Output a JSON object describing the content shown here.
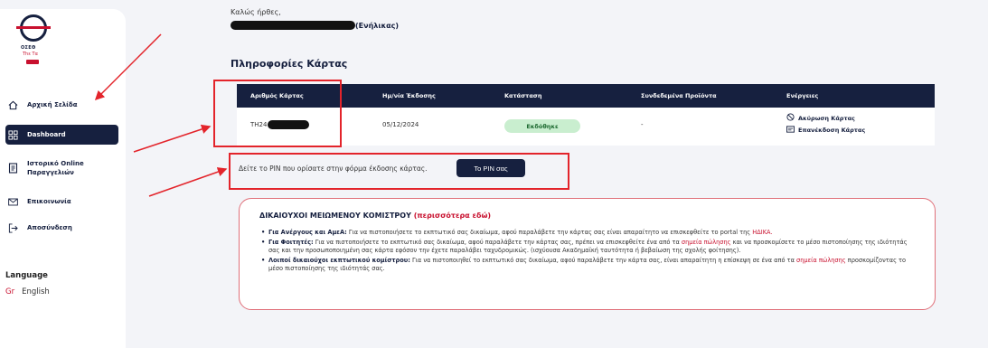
{
  "brand": {
    "title": "OΣΕΘ",
    "subtitle": "Thε Τα"
  },
  "sidebar": {
    "items": [
      {
        "label": "Αρχική Σελίδα",
        "icon": "home-icon"
      },
      {
        "label": "Dashboard",
        "icon": "dashboard-icon",
        "active": true
      },
      {
        "label": "Ιστορικό Online",
        "label2": "Παραγγελιών",
        "icon": "document-icon"
      },
      {
        "label": "Επικοινωνία",
        "icon": "mail-icon"
      },
      {
        "label": "Αποσύνδεση",
        "icon": "logout-icon"
      }
    ],
    "language_label": "Language",
    "languages": [
      "Gr",
      "English"
    ]
  },
  "main": {
    "greeting": "Καλώς ήρθες,",
    "user_type": "(Ενήλικας)",
    "section_title": "Πληροφορίες Κάρτας",
    "table": {
      "headers": [
        "Αριθμός Κάρτας",
        "Ημ/νία Έκδοσης",
        "Κατάσταση",
        "Συνδεδεμένα Προϊόντα",
        "Ενέργειες"
      ],
      "row": {
        "card_prefix": "TH24",
        "issue_date": "05/12/2024",
        "status": "Εκδόθηκε",
        "linked_products": "-",
        "actions": [
          {
            "label": "Ακύρωση Κάρτας",
            "icon": "cancel-icon"
          },
          {
            "label": "Επανέκδοση Κάρτας",
            "icon": "card-icon"
          }
        ]
      }
    },
    "pin": {
      "text": "Δείτε το PIN που ορίσατε στην φόρμα έκδοσης κάρτας.",
      "button": "Το PIN σας"
    },
    "info": {
      "title": "ΔΙΚΑΙΟΥΧΟΙ ΜΕΙΩΜΕΝΟΥ ΚΟΜΙΣΤΡΟΥ",
      "more": "(περισσότερα εδώ)",
      "items": [
        {
          "bold": "Για Ανέργους και ΑμεΑ:",
          "text": " Για να πιστοποιήσετε το εκπτωτικό σας δικαίωμα, αφού παραλάβετε την κάρτας σας είναι απαραίτητο να επισκεφθείτε το portal της ",
          "link": "ΗΔΙΚΑ."
        },
        {
          "bold": "Για Φοιτητές:",
          "text": " Για να πιστοποιήσετε το εκπτωτικό σας δικαίωμα, αφού παραλάβετε την κάρτας σας, πρέπει να επισκεφθείτε ένα από τα ",
          "link": "σημεία πώλησης",
          "text2": " και να προσκομίσετε το μέσο πιστοποίησης της ιδιότητάς σας και την προσωποποιημένη σας κάρτα εφόσον την έχετε παραλάβει ταχυδρομικώς. (ισχύουσα Ακαδημαϊκή ταυτότητα ή βεβαίωση της σχολής φοίτησης)."
        },
        {
          "bold": "Λοιποί δικαιούχοι εκπτωτικού κομίστρου:",
          "text": " Για να πιστοποιηθεί το εκπτωτικό σας δικαίωμα, αφού παραλάβετε την κάρτα σας, είναι απαραίτητη η επίσκεψη σε ένα από τα ",
          "link": "σημεία πώλησης",
          "text2": " προσκομίζοντας το μέσο πιστοποίησης της ιδιότητάς σας."
        }
      ]
    }
  },
  "colors": {
    "navy": "#16203f",
    "red": "#c8102e",
    "status_bg": "#c9eecf",
    "annotation": "#e3242b"
  }
}
